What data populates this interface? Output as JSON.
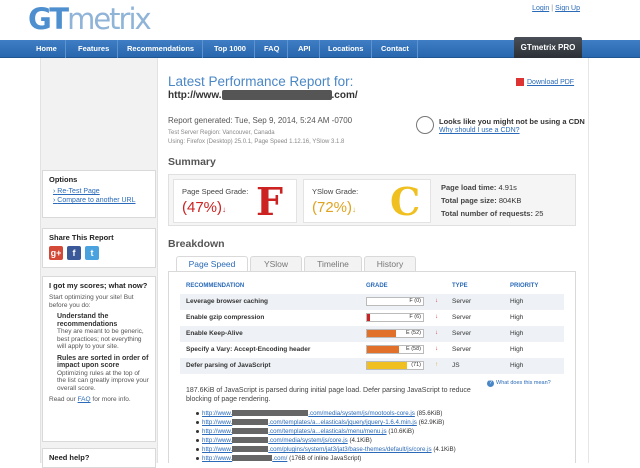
{
  "header": {
    "logo_gt": "GT",
    "logo_metrix": "metrix",
    "login": "Login",
    "signup": "Sign Up",
    "separator": "|"
  },
  "nav": {
    "items": [
      "Home",
      "Features",
      "Recommendations",
      "Top 1000",
      "FAQ",
      "API",
      "Locations",
      "Contact"
    ],
    "pro": "GTmetrix PRO"
  },
  "sidebar": {
    "options_title": "Options",
    "options": [
      "Re-Test Page",
      "Compare to another URL"
    ],
    "share_title": "Share This Report",
    "share_icons": [
      "google-plus-icon",
      "facebook-icon",
      "twitter-icon"
    ],
    "scores_title": "I got my scores; what now?",
    "scores_intro": "Start optimizing your site! But before you do:",
    "tip1_title": "Understand the recommendations",
    "tip1_text": "They are meant to be generic, best practices; not everything will apply to your site.",
    "tip2_title": "Rules are sorted in order of impact upon score",
    "tip2_text": "Optimizing rules at the top of the list can greatly improve your overall score.",
    "read_prefix": "Read our",
    "read_link": "FAQ",
    "read_suffix": "for more info.",
    "help_title": "Need help?"
  },
  "report": {
    "title": "Latest Performance Report for:",
    "url_prefix": "http://www.",
    "url_suffix": ".com/",
    "download_pdf": "Download PDF",
    "generated": "Report generated: Tue, Sep 9, 2014, 5:24 AM -0700",
    "server_region": "Test Server Region: Vancouver, Canada",
    "using": "Using: Firefox (Desktop) 25.0.1, Page Speed 1.12.16, YSlow 3.1.8",
    "cdn_title": "Looks like you might not be using a CDN",
    "cdn_link": "Why should I use a CDN?"
  },
  "summary": {
    "heading": "Summary",
    "pagespeed_label": "Page Speed Grade:",
    "pagespeed_pct": "(47%)",
    "pagespeed_grade": "F",
    "yslow_label": "YSlow Grade:",
    "yslow_pct": "(72%)",
    "yslow_grade": "C",
    "load_time_label": "Page load time:",
    "load_time": "4.91s",
    "page_size_label": "Total page size:",
    "page_size": "804KB",
    "requests_label": "Total number of requests:",
    "requests": "25",
    "colors": {
      "fail": "#cc2222",
      "warn": "#e0a320",
      "link": "#2a6ab8"
    }
  },
  "breakdown": {
    "heading": "Breakdown",
    "tabs": [
      "Page Speed",
      "YSlow",
      "Timeline",
      "History"
    ],
    "columns": [
      "RECOMMENDATION",
      "GRADE",
      "TYPE",
      "PRIORITY"
    ],
    "rows": [
      {
        "name": "Leverage browser caching",
        "grade": "F (0)",
        "score": 0,
        "arrow": "↓",
        "type": "Server",
        "priority": "High"
      },
      {
        "name": "Enable gzip compression",
        "grade": "F (6)",
        "score": 6,
        "arrow": "↓",
        "type": "Server",
        "priority": "High"
      },
      {
        "name": "Enable Keep-Alive",
        "grade": "E (52)",
        "score": 52,
        "arrow": "↓",
        "type": "Server",
        "priority": "High"
      },
      {
        "name": "Specify a Vary: Accept-Encoding header",
        "grade": "E (58)",
        "score": 58,
        "arrow": "↓",
        "type": "Server",
        "priority": "High"
      },
      {
        "name": "Defer parsing of JavaScript",
        "grade": "(71)",
        "score": 71,
        "arrow": "↑",
        "type": "JS",
        "priority": "High"
      }
    ],
    "what_does": "What does this mean?",
    "description": "187.6KiB of JavaScript is parsed during initial page load. Defer parsing JavaScript to reduce blocking of page rendering.",
    "resources": [
      {
        "prefix": "http://www.",
        "suffix": ".com/media/system/js/mootools-core.js",
        "size": "(85.6KiB)"
      },
      {
        "prefix": "http://www.",
        "suffix": ".com/templates/a...elasticals/jquery/jquery-1.6.4.min.js",
        "size": "(62.9KiB)"
      },
      {
        "prefix": "http://www.",
        "suffix": ".com/templates/a...elasticals/menu/menu.js",
        "size": "(10.6KiB)"
      },
      {
        "prefix": "http://www.",
        "suffix": ".com/media/system/js/core.js",
        "size": "(4.1KiB)"
      },
      {
        "prefix": "http://www.",
        "suffix": ".com/plugins/system/jat3/jat3/base-themes/default/js/core.js",
        "size": "(4.1KiB)"
      },
      {
        "prefix": "http://www.",
        "suffix": ".com/",
        "size": "(176B of inline JavaScript)"
      }
    ]
  }
}
